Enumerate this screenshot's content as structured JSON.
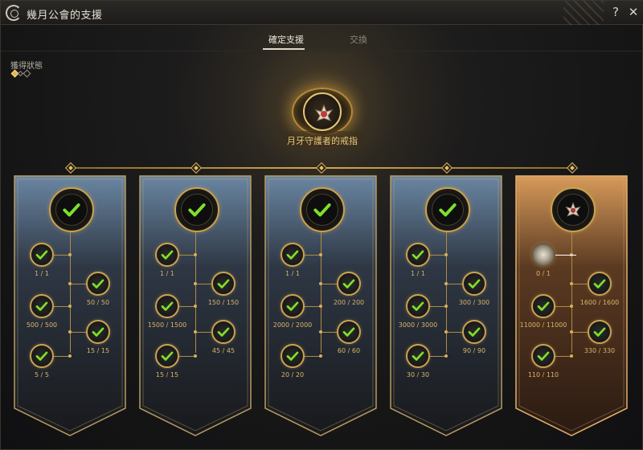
{
  "window": {
    "title": "幾月公會的支援",
    "help": "?",
    "close": "✕"
  },
  "tabs": [
    {
      "label": "確定支援",
      "active": true
    },
    {
      "label": "交換",
      "active": false
    }
  ],
  "status": {
    "label": "獲得狀態",
    "indicators": [
      "on",
      "off",
      "off"
    ]
  },
  "top_reward": {
    "name": "月牙守護者的戒指",
    "icon": "ring-icon"
  },
  "colors": {
    "gold": "#d4a84e",
    "check": "#7fe02a",
    "banner_blue": "#5a7591",
    "banner_orange": "#c88a4a"
  },
  "banners": [
    {
      "complete": true,
      "main_icon": "check-icon",
      "nodes": [
        {
          "label": "1 / 1"
        },
        {
          "label": "50 / 50"
        },
        {
          "label": "500 / 500"
        },
        {
          "label": "15 / 15"
        },
        {
          "label": "5 / 5"
        }
      ]
    },
    {
      "complete": true,
      "main_icon": "check-icon",
      "nodes": [
        {
          "label": "1 / 1"
        },
        {
          "label": "150 / 150"
        },
        {
          "label": "1500 / 1500"
        },
        {
          "label": "45 / 45"
        },
        {
          "label": "15 / 15"
        }
      ]
    },
    {
      "complete": true,
      "main_icon": "check-icon",
      "nodes": [
        {
          "label": "1 / 1"
        },
        {
          "label": "200 / 200"
        },
        {
          "label": "2000 / 2000"
        },
        {
          "label": "60 / 60"
        },
        {
          "label": "20 / 20"
        }
      ]
    },
    {
      "complete": true,
      "main_icon": "check-icon",
      "nodes": [
        {
          "label": "1 / 1"
        },
        {
          "label": "300 / 300"
        },
        {
          "label": "3000 / 3000"
        },
        {
          "label": "90 / 90"
        },
        {
          "label": "30 / 30"
        }
      ]
    },
    {
      "complete": false,
      "main_icon": "ring-icon",
      "nodes": [
        {
          "label": "0 / 1"
        },
        {
          "label": "1600 / 1600"
        },
        {
          "label": "11000 / 11000"
        },
        {
          "label": "330 / 330"
        },
        {
          "label": "110 / 110"
        }
      ]
    }
  ]
}
